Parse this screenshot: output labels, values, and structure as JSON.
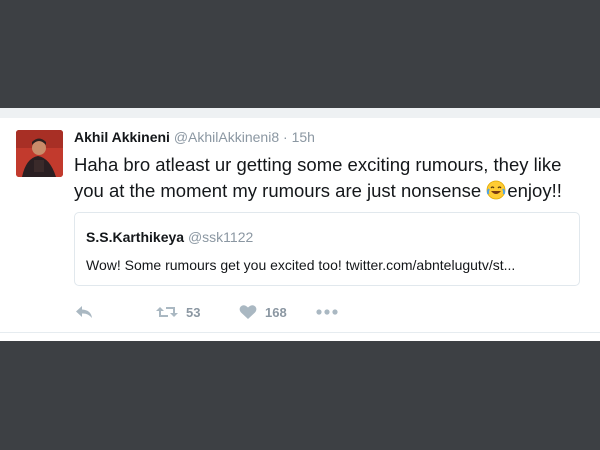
{
  "tweet": {
    "name": "Akhil Akkineni",
    "handle": "@AkhilAkkineni8",
    "separator": "·",
    "time": "15h",
    "text_part1": "Haha bro atleast ur getting some exciting rumours, they like you at the moment my rumours are just nonsense ",
    "text_part2": "enjoy!!",
    "emoji_icon": "face-with-tears-of-joy-icon"
  },
  "quoted_tweet": {
    "name": "S.S.Karthikeya",
    "handle": "@ssk1122",
    "text": "Wow! Some rumours get you excited too!   twitter.com/abntelugutv/st..."
  },
  "actions": {
    "reply_icon": "reply-icon",
    "retweet_icon": "retweet-icon",
    "retweet_count": "53",
    "like_icon": "heart-icon",
    "like_count": "168",
    "more_icon": "more-icon"
  },
  "colors": {
    "background": "#3d4044",
    "card": "#ffffff",
    "muted_text": "#8b97a2",
    "icon_gray": "#aab8c2"
  }
}
